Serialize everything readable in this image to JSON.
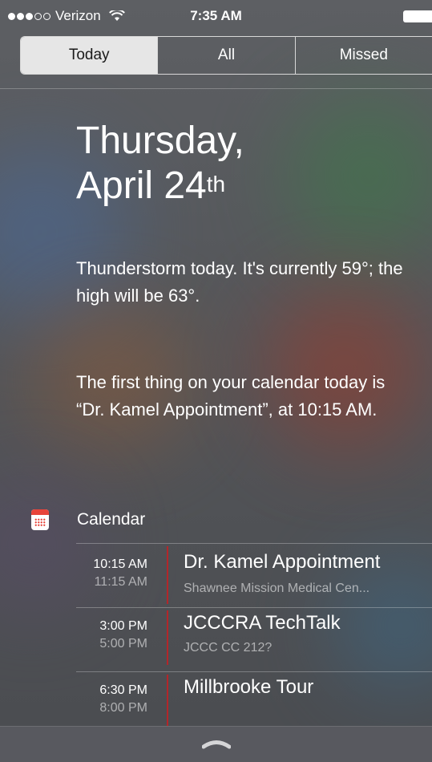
{
  "status_bar": {
    "carrier": "Verizon",
    "time": "7:35 AM"
  },
  "tabs": [
    {
      "label": "Today",
      "active": true
    },
    {
      "label": "All",
      "active": false
    },
    {
      "label": "Missed",
      "active": false
    }
  ],
  "date": {
    "weekday": "Thursday,",
    "month_day": "April 24",
    "suffix": "th"
  },
  "weather_summary": "Thunderstorm today. It's currently 59°; the high will be 63°.",
  "calendar_summary": "The first thing on your calendar today is “Dr. Kamel Appointment”, at 10:15 AM.",
  "calendar": {
    "title": "Calendar",
    "icon": "calendar-icon",
    "accent_color": "#b3262a",
    "events": [
      {
        "start": "10:15 AM",
        "end": "11:15 AM",
        "title": "Dr. Kamel Appointment",
        "location": "Shawnee Mission Medical Cen..."
      },
      {
        "start": "3:00 PM",
        "end": "5:00 PM",
        "title": "JCCCRA TechTalk",
        "location": "JCCC CC 212?"
      },
      {
        "start": "6:30 PM",
        "end": "8:00 PM",
        "title": "Millbrooke Tour",
        "location": ""
      }
    ]
  }
}
